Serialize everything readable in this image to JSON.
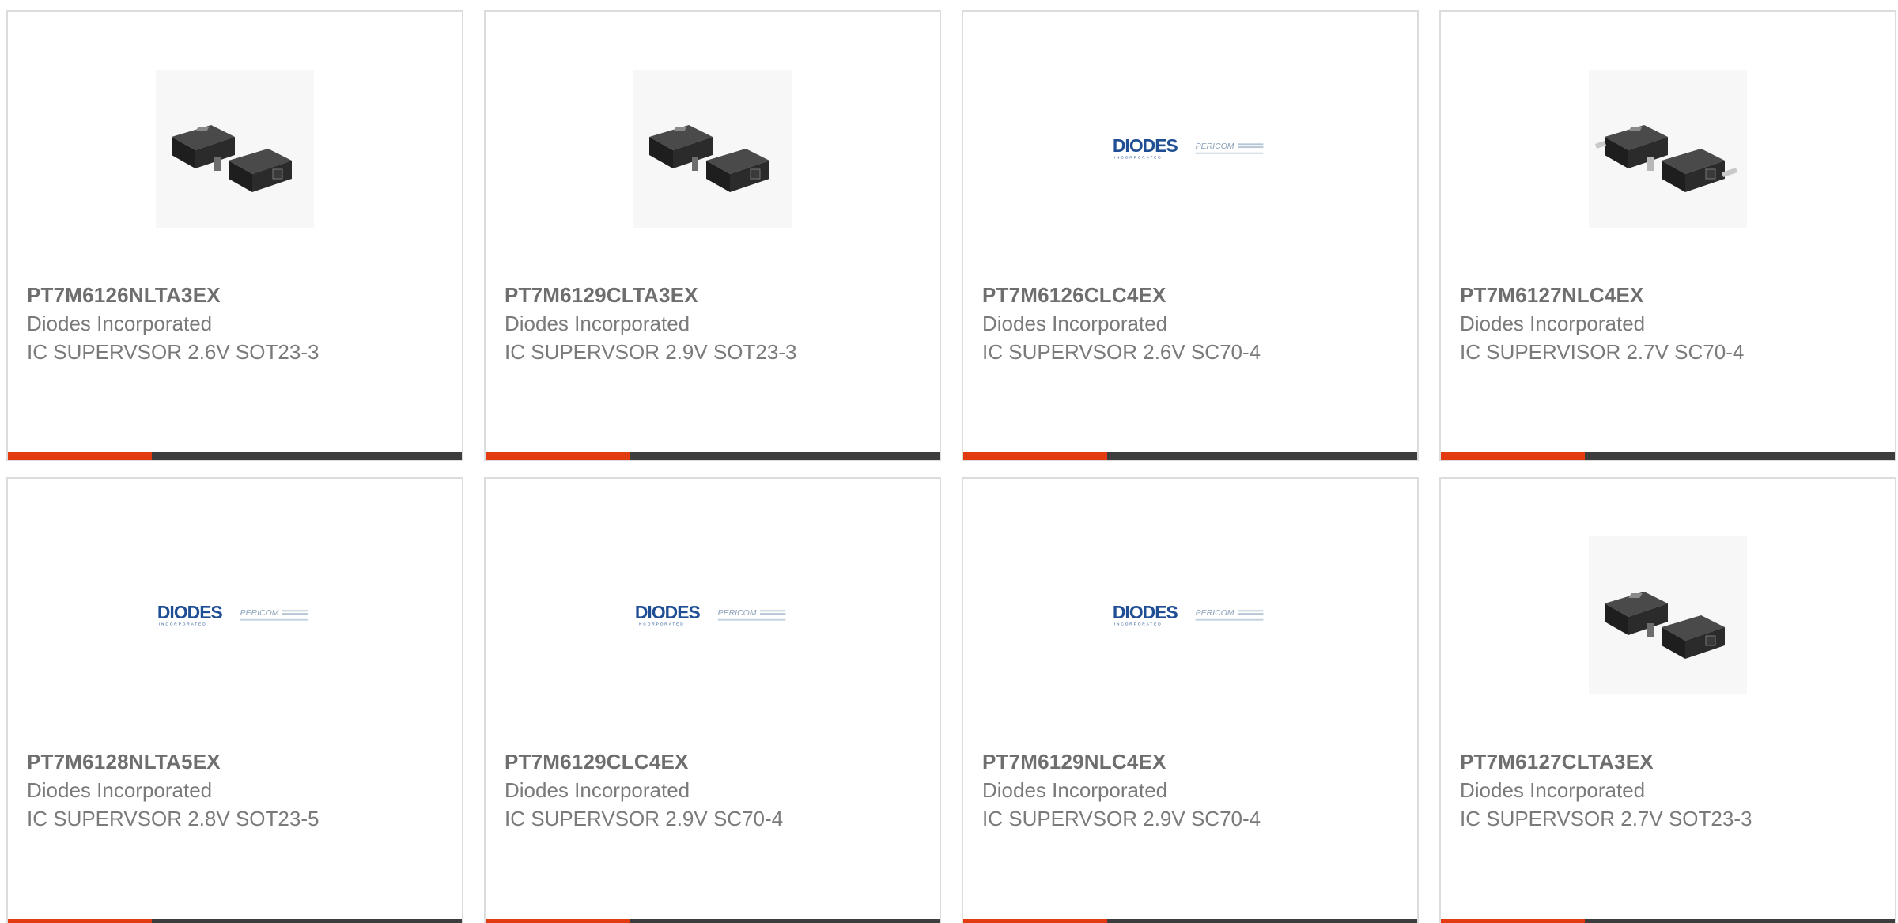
{
  "colors": {
    "accent": "#e23b12",
    "bar": "#3d3d3d",
    "border": "#dcdcdc",
    "text": "#6e6e6e",
    "logo_blue": "#1f4e94"
  },
  "cards": [
    {
      "part": "PT7M6126NLTA3EX",
      "maker": "Diodes Incorporated",
      "desc": "IC SUPERVSOR 2.6V SOT23-3",
      "image": "sot23-3-chip-icon"
    },
    {
      "part": "PT7M6129CLTA3EX",
      "maker": "Diodes Incorporated",
      "desc": "IC SUPERVSOR 2.9V SOT23-3",
      "image": "sot23-3-chip-icon"
    },
    {
      "part": "PT7M6126CLC4EX",
      "maker": "Diodes Incorporated",
      "desc": "IC SUPERVSOR 2.6V SC70-4",
      "image": "diodes-pericom-logo"
    },
    {
      "part": "PT7M6127NLC4EX",
      "maker": "Diodes Incorporated",
      "desc": "IC SUPERVISOR 2.7V SC70-4",
      "image": "sc70-4-chip-icon"
    },
    {
      "part": "PT7M6128NLTA5EX",
      "maker": "Diodes Incorporated",
      "desc": "IC SUPERVSOR 2.8V SOT23-5",
      "image": "diodes-pericom-logo"
    },
    {
      "part": "PT7M6129CLC4EX",
      "maker": "Diodes Incorporated",
      "desc": "IC SUPERVSOR 2.9V SC70-4",
      "image": "diodes-pericom-logo"
    },
    {
      "part": "PT7M6129NLC4EX",
      "maker": "Diodes Incorporated",
      "desc": "IC SUPERVSOR 2.9V SC70-4",
      "image": "diodes-pericom-logo"
    },
    {
      "part": "PT7M6127CLTA3EX",
      "maker": "Diodes Incorporated",
      "desc": "IC SUPERVSOR 2.7V SOT23-3",
      "image": "sot23-3-chip-icon"
    }
  ],
  "logo": {
    "brand": "DIODES",
    "brand_sub": "INCORPORATED",
    "partner": "PERICOM"
  }
}
